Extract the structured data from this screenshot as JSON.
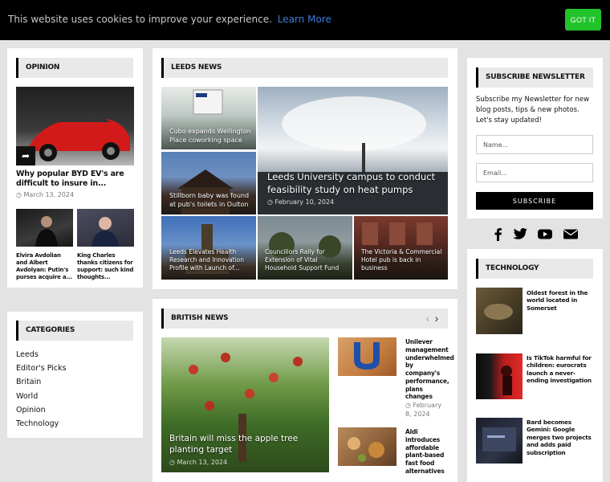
{
  "cookie": {
    "text": "This website uses cookies to improve your experience.",
    "link": "Learn More",
    "button": "GOT IT"
  },
  "opinion": {
    "title": "OPINION",
    "main": {
      "title": "Why popular BYD EV's are difficult to insure in...",
      "date": "March 13, 2024"
    },
    "small": [
      {
        "title": "Elvira Avdolian and Albert Avdolyan: Putin's purses acquire a..."
      },
      {
        "title": "King Charles thanks citizens for support: such kind thoughts..."
      }
    ]
  },
  "categories": {
    "title": "CATEGORIES",
    "items": [
      "Leeds",
      "Editor's Picks",
      "Britain",
      "World",
      "Opinion",
      "Technology"
    ]
  },
  "leeds": {
    "title": "LEEDS NEWS",
    "main": {
      "title": "Leeds University campus to conduct feasibility study on heat pumps",
      "date": "February 10, 2024"
    },
    "left": [
      {
        "title": "Cubo expands Wellington Place coworking space"
      },
      {
        "title": "Stillborn baby was found at pub's toilets in Oulton"
      }
    ],
    "bottom": [
      {
        "title": "Leeds Elevates Health Research and Innovation Profile with Launch of..."
      },
      {
        "title": "Councillors Rally for Extension of Vital Household Support Fund"
      },
      {
        "title": "The Victoria & Commercial Hotel pub is back in business"
      }
    ]
  },
  "british": {
    "title": "BRITISH NEWS",
    "main": {
      "title": "Britain will miss the apple tree planting target",
      "date": "March 13, 2024"
    },
    "side": [
      {
        "title": "Unilever management underwhelmed by company's performance, plans changes",
        "date": "February 8, 2024"
      },
      {
        "title": "Aldi introduces affordable plant-based fast food alternatives"
      }
    ]
  },
  "newsletter": {
    "title": "SUBSCRIBE NEWSLETTER",
    "text": "Subscribe my Newsletter for new blog posts, tips & new photos. Let's stay updated!",
    "name_placeholder": "Name...",
    "email_placeholder": "Email...",
    "button": "SUBSCRIBE"
  },
  "technology": {
    "title": "TECHNOLOGY",
    "items": [
      {
        "title": "Oldest forest in the world located in Somerset"
      },
      {
        "title": "Is TikTok harmful for children: eurocrats launch a never-ending investigation"
      },
      {
        "title": "Bard becomes Gemini: Google merges two projects and adds paid subscription"
      }
    ]
  },
  "icons": {
    "share": "share-icon",
    "clock": "clock-icon",
    "social": [
      "facebook-icon",
      "twitter-icon",
      "youtube-icon",
      "email-icon"
    ]
  }
}
